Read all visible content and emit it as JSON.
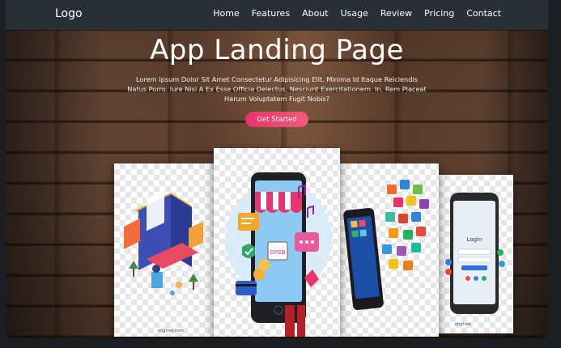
{
  "header": {
    "logo": "Logo",
    "nav": [
      "Home",
      "Features",
      "About",
      "Usage",
      "Review",
      "Pricing",
      "Contact"
    ]
  },
  "hero": {
    "title": "App Landing Page",
    "subtitle": "Lorem Ipsum Dolor Sit Amet Consectetur Adipisicing Elit. Minima Id Itaque Reiciendis Natus Porro. Iure Nisi A Ex Esse Officia Delectus, Nesciunt Exercitationem. In, Rem Placeat Harum Voluptatem Fugit Nobis?",
    "cta_label": "Get Started"
  },
  "gallery": {
    "cards": [
      {
        "name": "isometric-ui-illustration",
        "watermark": "pngtree.com"
      },
      {
        "name": "mobile-store-open-illustration",
        "sign": "OPEN"
      },
      {
        "name": "phone-with-app-icons",
        "watermark": ""
      },
      {
        "name": "login-screen-phone",
        "screen_label": "Login",
        "watermark": "pngtree"
      }
    ]
  },
  "colors": {
    "navbar": "#2a2f35",
    "cta_start": "#e8336b",
    "cta_end": "#f15b7a"
  }
}
